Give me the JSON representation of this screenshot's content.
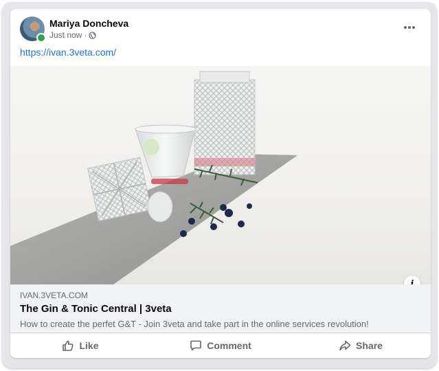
{
  "post": {
    "author": "Mariya Doncheva",
    "time": "Just now",
    "separator": "·",
    "privacy_icon": "globe-icon",
    "options_icon": "more-options-icon",
    "link_text": "https://ivan.3veta.com/"
  },
  "link_preview": {
    "domain": "IVAN.3VETA.COM",
    "title": "The Gin & Tonic Central | 3veta",
    "description": "How to create the perfet G&T - Join 3veta and take part in the online services revolution!",
    "info_icon": "info-icon",
    "info_glyph": "i"
  },
  "actions": [
    {
      "label": "Like",
      "icon": "thumbs-up-icon"
    },
    {
      "label": "Comment",
      "icon": "comment-icon"
    },
    {
      "label": "Share",
      "icon": "share-icon"
    }
  ],
  "colors": {
    "link_blue": "#216fdb",
    "online_green": "#31a24c",
    "secondary_text": "#65676b",
    "preview_bg": "#f0f2f5"
  }
}
